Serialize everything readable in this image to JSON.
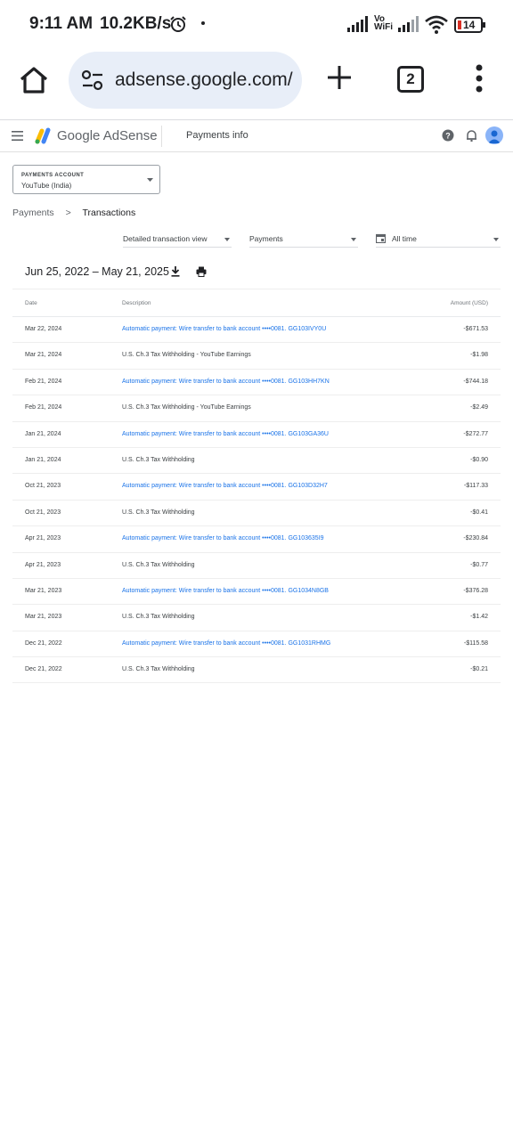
{
  "status_bar": {
    "time": "9:11 AM",
    "speed": "10.2KB/s",
    "vowifi_top": "Vo",
    "vowifi_bottom": "WiFi",
    "battery": "14"
  },
  "browser": {
    "url": "adsense.google.com/",
    "tab_count": "2"
  },
  "header": {
    "brand": "Google AdSense",
    "page_title": "Payments info"
  },
  "payments_account": {
    "label": "PAYMENTS ACCOUNT",
    "value": "YouTube (India)"
  },
  "breadcrumb": {
    "parent": "Payments",
    "separator": ">",
    "current": "Transactions"
  },
  "filters": {
    "view": "Detailed transaction view",
    "type": "Payments",
    "range": "All time"
  },
  "date_range": "Jun 25, 2022 – May 21, 2025",
  "table": {
    "columns": {
      "date": "Date",
      "description": "Description",
      "amount": "Amount (USD)"
    },
    "rows": [
      {
        "date": "Mar 22, 2024",
        "description": "Automatic payment: Wire transfer to bank account ••••0081. GG103IVY0U",
        "amount": "-$671.53",
        "link": true
      },
      {
        "date": "Mar 21, 2024",
        "description": "U.S. Ch.3 Tax Withholding - YouTube Earnings",
        "amount": "-$1.98",
        "link": false
      },
      {
        "date": "Feb 21, 2024",
        "description": "Automatic payment: Wire transfer to bank account ••••0081. GG103HH7KN",
        "amount": "-$744.18",
        "link": true
      },
      {
        "date": "Feb 21, 2024",
        "description": "U.S. Ch.3 Tax Withholding - YouTube Earnings",
        "amount": "-$2.49",
        "link": false
      },
      {
        "date": "Jan 21, 2024",
        "description": "Automatic payment: Wire transfer to bank account ••••0081. GG103GA36U",
        "amount": "-$272.77",
        "link": true
      },
      {
        "date": "Jan 21, 2024",
        "description": "U.S. Ch.3 Tax Withholding",
        "amount": "-$0.90",
        "link": false
      },
      {
        "date": "Oct 21, 2023",
        "description": "Automatic payment: Wire transfer to bank account ••••0081. GG103D32H7",
        "amount": "-$117.33",
        "link": true
      },
      {
        "date": "Oct 21, 2023",
        "description": "U.S. Ch.3 Tax Withholding",
        "amount": "-$0.41",
        "link": false
      },
      {
        "date": "Apr 21, 2023",
        "description": "Automatic payment: Wire transfer to bank account ••••0081. GG103635I9",
        "amount": "-$230.84",
        "link": true
      },
      {
        "date": "Apr 21, 2023",
        "description": "U.S. Ch.3 Tax Withholding",
        "amount": "-$0.77",
        "link": false
      },
      {
        "date": "Mar 21, 2023",
        "description": "Automatic payment: Wire transfer to bank account ••••0081. GG1034N8GB",
        "amount": "-$376.28",
        "link": true
      },
      {
        "date": "Mar 21, 2023",
        "description": "U.S. Ch.3 Tax Withholding",
        "amount": "-$1.42",
        "link": false
      },
      {
        "date": "Dec 21, 2022",
        "description": "Automatic payment: Wire transfer to bank account ••••0081. GG1031RHMG",
        "amount": "-$115.58",
        "link": true
      },
      {
        "date": "Dec 21, 2022",
        "description": "U.S. Ch.3 Tax Withholding",
        "amount": "-$0.21",
        "link": false
      }
    ]
  },
  "colors": {
    "link": "#1a73e8",
    "url_bar_bg": "#e8eef8",
    "battery_low": "#d93025"
  }
}
